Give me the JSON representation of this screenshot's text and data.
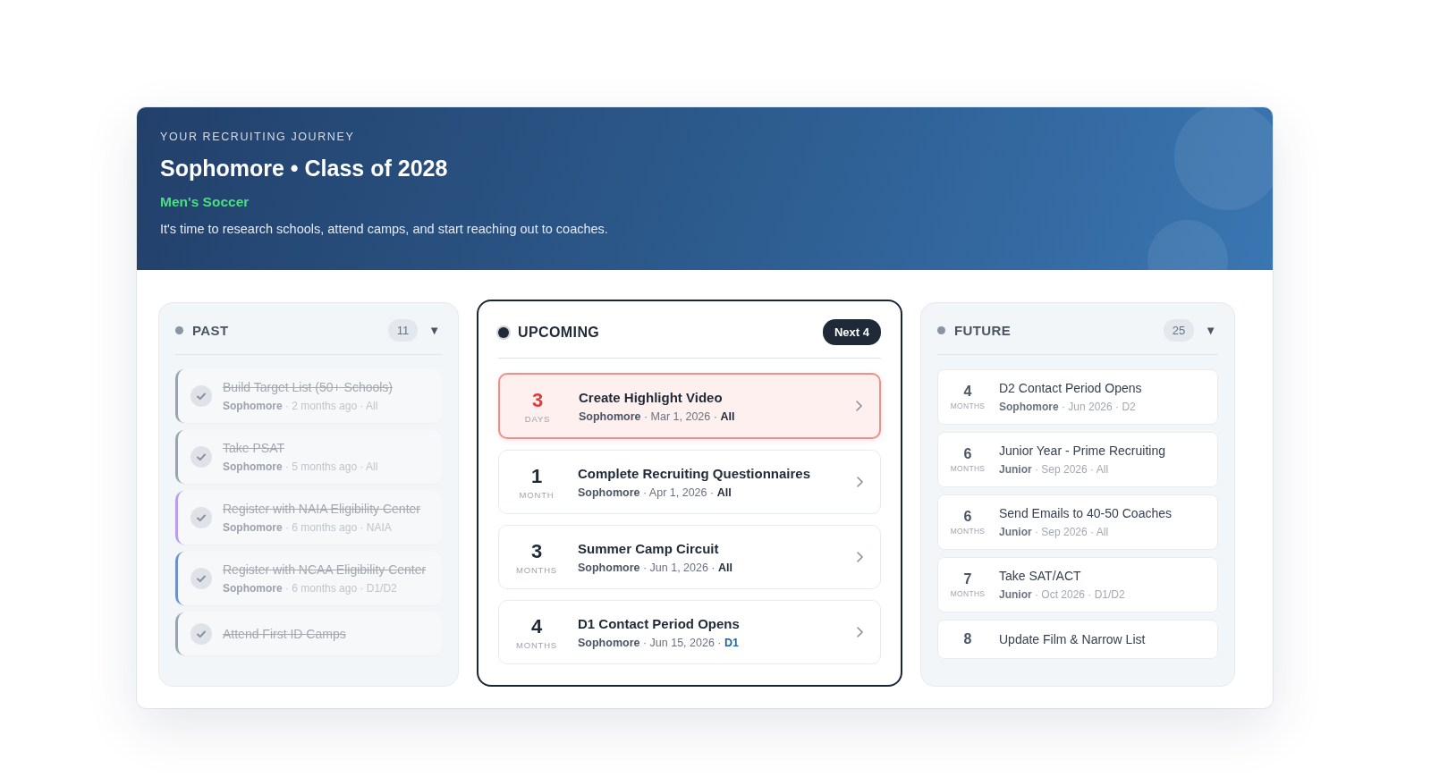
{
  "header": {
    "eyebrow": "YOUR RECRUITING JOURNEY",
    "title": "Sophomore • Class of 2028",
    "sport": "Men's Soccer",
    "description": "It's time to research schools, attend camps, and start reaching out to coaches."
  },
  "past": {
    "title": "PAST",
    "count": "11",
    "toggle": "▼",
    "items": [
      {
        "title": "Build Target List (50+ Schools)",
        "meta": "**Sophomore** · 2 months ago · All",
        "checked": true,
        "color": "#9ca3af"
      },
      {
        "title": "Take PSAT",
        "meta": "**Sophomore** · 5 months ago · All",
        "checked": true,
        "color": "#9ca3af"
      },
      {
        "title": "Register with NAIA Eligibility Center",
        "meta": "**Sophomore** · 6 months ago · NAIA",
        "checked": true,
        "color": "#b79cf0"
      },
      {
        "title": "Register with NCAA Eligibility Center",
        "meta": "**Sophomore** · 6 months ago · D1/D2",
        "checked": true,
        "color": "#6f8fd0"
      },
      {
        "title": "Attend First ID Camps",
        "checked": true,
        "color": "#9ca3af"
      }
    ]
  },
  "upcoming": {
    "title": "UPCOMING",
    "badge": "Next 4",
    "items": [
      {
        "number": "3",
        "unit": "DAYS",
        "title": "Create Highlight Video",
        "meta": "**Sophomore** · Mar 1, 2026 ·",
        "division": "All",
        "urgent": true,
        "color": "#1f2937"
      },
      {
        "number": "1",
        "unit": "MONTH",
        "title": "Complete Recruiting Questionnaires",
        "meta": "**Sophomore** · Apr 1, 2026 ·",
        "division": "All",
        "urgent": false,
        "color": "#1f2937"
      },
      {
        "number": "3",
        "unit": "MONTHS",
        "title": "Summer Camp Circuit",
        "meta": "**Sophomore** · Jun 1, 2026 ·",
        "division": "All",
        "urgent": false,
        "color": "#1f2937"
      },
      {
        "number": "4",
        "unit": "MONTHS",
        "title": "D1 Contact Period Opens",
        "meta": "**Sophomore** · Jun 15, 2026 ·",
        "division": "D1",
        "urgent": false,
        "color": "#2563a8"
      }
    ]
  },
  "future": {
    "title": "FUTURE",
    "count": "25",
    "toggle": "▼",
    "items": [
      {
        "number": "4",
        "unit": "MONTHS",
        "title": "D2 Contact Period Opens",
        "meta": "**Sophomore** · Jun 2026 · D2"
      },
      {
        "number": "6",
        "unit": "MONTHS",
        "title": "Junior Year - Prime Recruiting",
        "meta": "**Junior** · Sep 2026 · All"
      },
      {
        "number": "6",
        "unit": "MONTHS",
        "title": "Send Emails to 40-50 Coaches",
        "meta": "**Junior** · Sep 2026 · All"
      },
      {
        "number": "7",
        "unit": "MONTHS",
        "title": "Take SAT/ACT",
        "meta": "**Junior** · Oct 2026 · D1/D2"
      },
      {
        "number": "8",
        "title": "Update Film & Narrow List"
      }
    ]
  }
}
